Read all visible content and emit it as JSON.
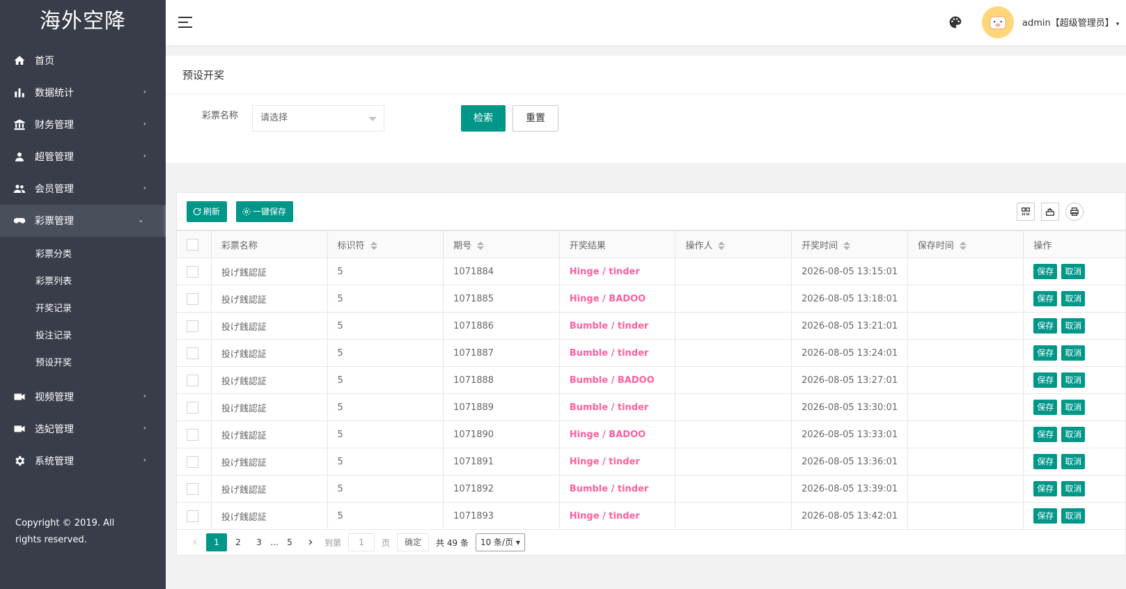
{
  "app": {
    "logo": "海外空降"
  },
  "sidebar": {
    "items": [
      {
        "label": "首页",
        "arrow": ""
      },
      {
        "label": "数据统计",
        "arrow": "›"
      },
      {
        "label": "财务管理",
        "arrow": "›"
      },
      {
        "label": "超管管理",
        "arrow": "›"
      },
      {
        "label": "会员管理",
        "arrow": "›"
      },
      {
        "label": "彩票管理",
        "arrow": "⌄"
      },
      {
        "label": "视频管理",
        "arrow": "›"
      },
      {
        "label": "选妃管理",
        "arrow": "›"
      },
      {
        "label": "系统管理",
        "arrow": "›"
      }
    ],
    "subitems": [
      "彩票分类",
      "彩票列表",
      "开奖记录",
      "投注记录",
      "预设开奖"
    ],
    "copyright": "Copyright © 2019. All rights reserved."
  },
  "header": {
    "user": "admin【超级管理员】",
    "caret": "▾"
  },
  "search": {
    "title": "预设开奖",
    "label": "彩票名称",
    "placeholder": "请选择",
    "search_btn": "检索",
    "reset_btn": "重置"
  },
  "toolbar": {
    "refresh": "刷新",
    "save_all": "一键保存"
  },
  "table": {
    "columns": [
      "彩票名称",
      "标识符",
      "期号",
      "开奖结果",
      "操作人",
      "开奖时间",
      "保存时间",
      "操作"
    ],
    "rows": [
      {
        "name": "投げ銭認証",
        "id": "5",
        "period": "1071884",
        "result": "Hinge / tinder",
        "operator": "",
        "time": "2026-08-05 13:15:01",
        "saved": ""
      },
      {
        "name": "投げ銭認証",
        "id": "5",
        "period": "1071885",
        "result": "Hinge / BADOO",
        "operator": "",
        "time": "2026-08-05 13:18:01",
        "saved": ""
      },
      {
        "name": "投げ銭認証",
        "id": "5",
        "period": "1071886",
        "result": "Bumble / tinder",
        "operator": "",
        "time": "2026-08-05 13:21:01",
        "saved": ""
      },
      {
        "name": "投げ銭認証",
        "id": "5",
        "period": "1071887",
        "result": "Bumble / tinder",
        "operator": "",
        "time": "2026-08-05 13:24:01",
        "saved": ""
      },
      {
        "name": "投げ銭認証",
        "id": "5",
        "period": "1071888",
        "result": "Bumble / BADOO",
        "operator": "",
        "time": "2026-08-05 13:27:01",
        "saved": ""
      },
      {
        "name": "投げ銭認証",
        "id": "5",
        "period": "1071889",
        "result": "Bumble / tinder",
        "operator": "",
        "time": "2026-08-05 13:30:01",
        "saved": ""
      },
      {
        "name": "投げ銭認証",
        "id": "5",
        "period": "1071890",
        "result": "Hinge / BADOO",
        "operator": "",
        "time": "2026-08-05 13:33:01",
        "saved": ""
      },
      {
        "name": "投げ銭認証",
        "id": "5",
        "period": "1071891",
        "result": "Hinge / tinder",
        "operator": "",
        "time": "2026-08-05 13:36:01",
        "saved": ""
      },
      {
        "name": "投げ銭認証",
        "id": "5",
        "period": "1071892",
        "result": "Bumble / tinder",
        "operator": "",
        "time": "2026-08-05 13:39:01",
        "saved": ""
      },
      {
        "name": "投げ銭認証",
        "id": "5",
        "period": "1071893",
        "result": "Hinge / tinder",
        "operator": "",
        "time": "2026-08-05 13:42:01",
        "saved": ""
      }
    ],
    "save_btn": "保存",
    "cancel_btn": "取消"
  },
  "pager": {
    "prev": "‹",
    "pages": [
      "1",
      "2",
      "3"
    ],
    "ellipsis": "…",
    "last": "5",
    "next": "›",
    "goto": "到第",
    "goto_value": "1",
    "page_unit": "页",
    "confirm": "确定",
    "total": "共 49 条",
    "per_page": "10 条/页"
  },
  "colors": {
    "accent": "#009688",
    "sidebar": "#393d49",
    "result": "#ff5fa0"
  }
}
